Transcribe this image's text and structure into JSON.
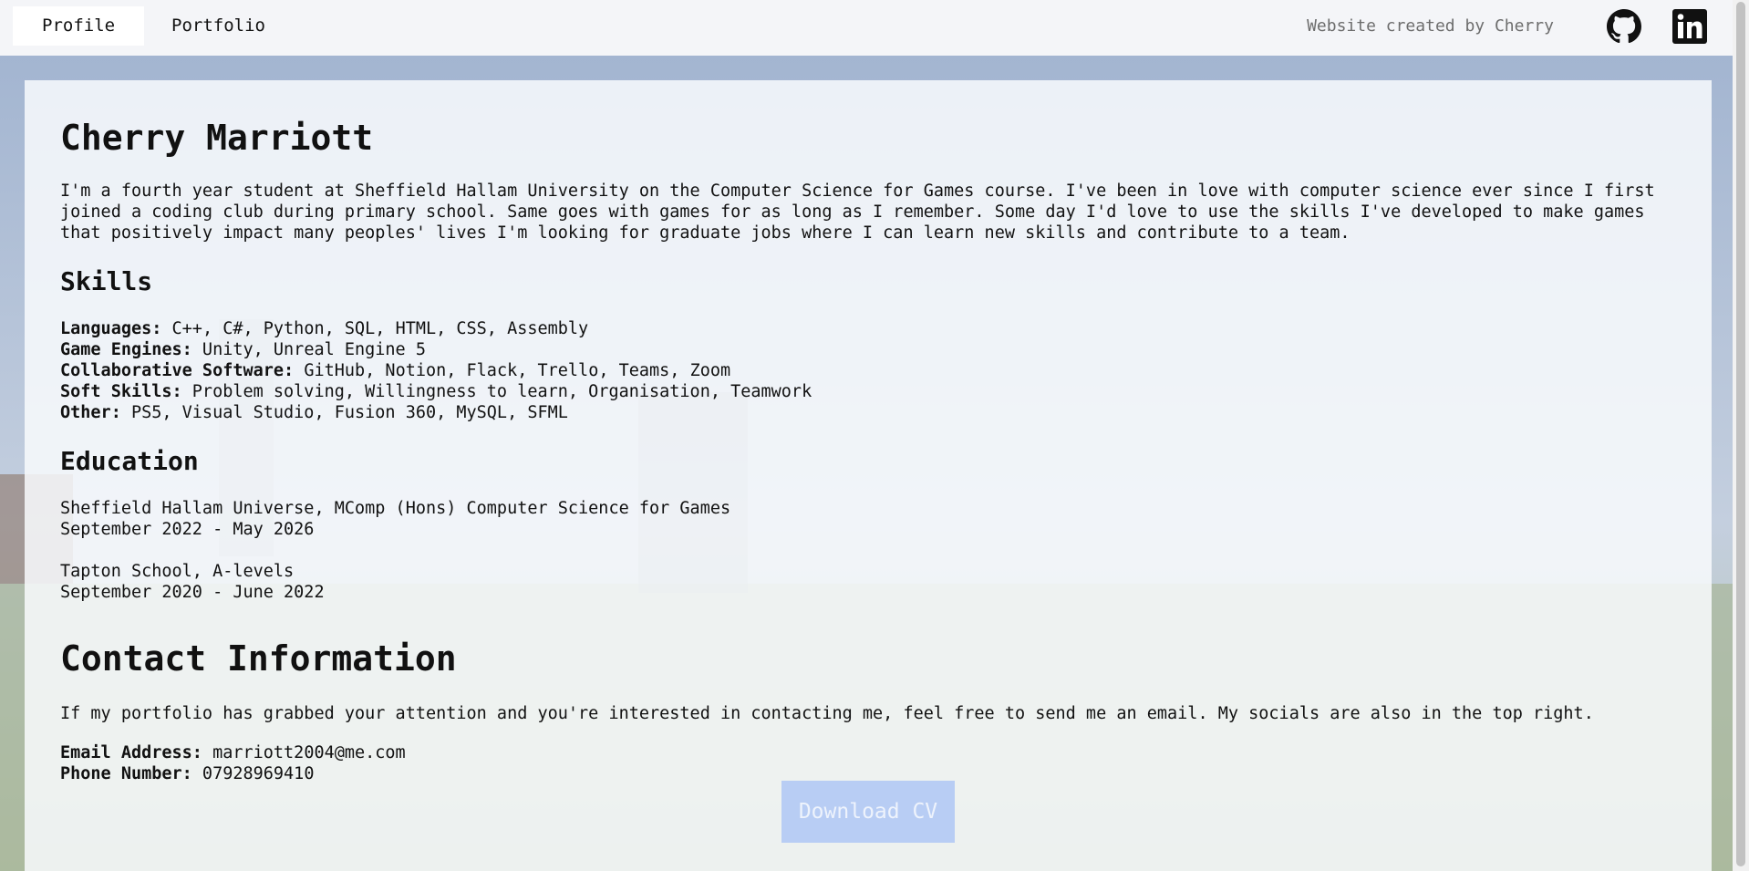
{
  "nav": {
    "tabs": [
      {
        "label": "Profile",
        "active": true
      },
      {
        "label": "Portfolio",
        "active": false
      }
    ],
    "credit": "Website created by Cherry",
    "socials": [
      {
        "icon": "github-icon"
      },
      {
        "icon": "linkedin-icon"
      }
    ]
  },
  "profile": {
    "name": "Cherry Marriott",
    "bio": "I'm a fourth year student at Sheffield Hallam University on the Computer Science for Games course. I've been in love with computer science ever since I first joined a coding club during primary school. Same goes with games for as long as I remember. Some day I'd love to use the skills I've developed to make games that positively impact many peoples' lives I'm looking for graduate jobs where I can learn new skills and contribute to a team."
  },
  "skills": {
    "heading": "Skills",
    "items": [
      {
        "key": "Languages:",
        "value": " C++, C#, Python, SQL, HTML, CSS, Assembly"
      },
      {
        "key": "Game Engines:",
        "value": " Unity, Unreal Engine 5"
      },
      {
        "key": "Collaborative Software:",
        "value": " GitHub, Notion, Flack, Trello, Teams, Zoom"
      },
      {
        "key": "Soft Skills:",
        "value": " Problem solving, Willingness to learn, Organisation, Teamwork"
      },
      {
        "key": "Other:",
        "value": " PS5, Visual Studio, Fusion 360, MySQL, SFML"
      }
    ]
  },
  "education": {
    "heading": "Education",
    "items": [
      {
        "title": "Sheffield Hallam Universe, MComp (Hons) Computer Science for Games",
        "dates": "September 2022 - May 2026"
      },
      {
        "title": "Tapton School, A-levels",
        "dates": "September 2020 - June 2022"
      }
    ]
  },
  "contact": {
    "heading": "Contact Information",
    "intro": "If my portfolio has grabbed your attention and you're interested in contacting me, feel free to send me an email. My socials are also in the top right.",
    "email_label": "Email Address:",
    "email": " marriott2004@me.com",
    "phone_label": "Phone Number:",
    "phone": " 07928969410"
  },
  "cv_button": "Download CV",
  "colors": {
    "cv_button_bg": "#b8cdf4",
    "topbar_bg": "#f4f5f8"
  }
}
